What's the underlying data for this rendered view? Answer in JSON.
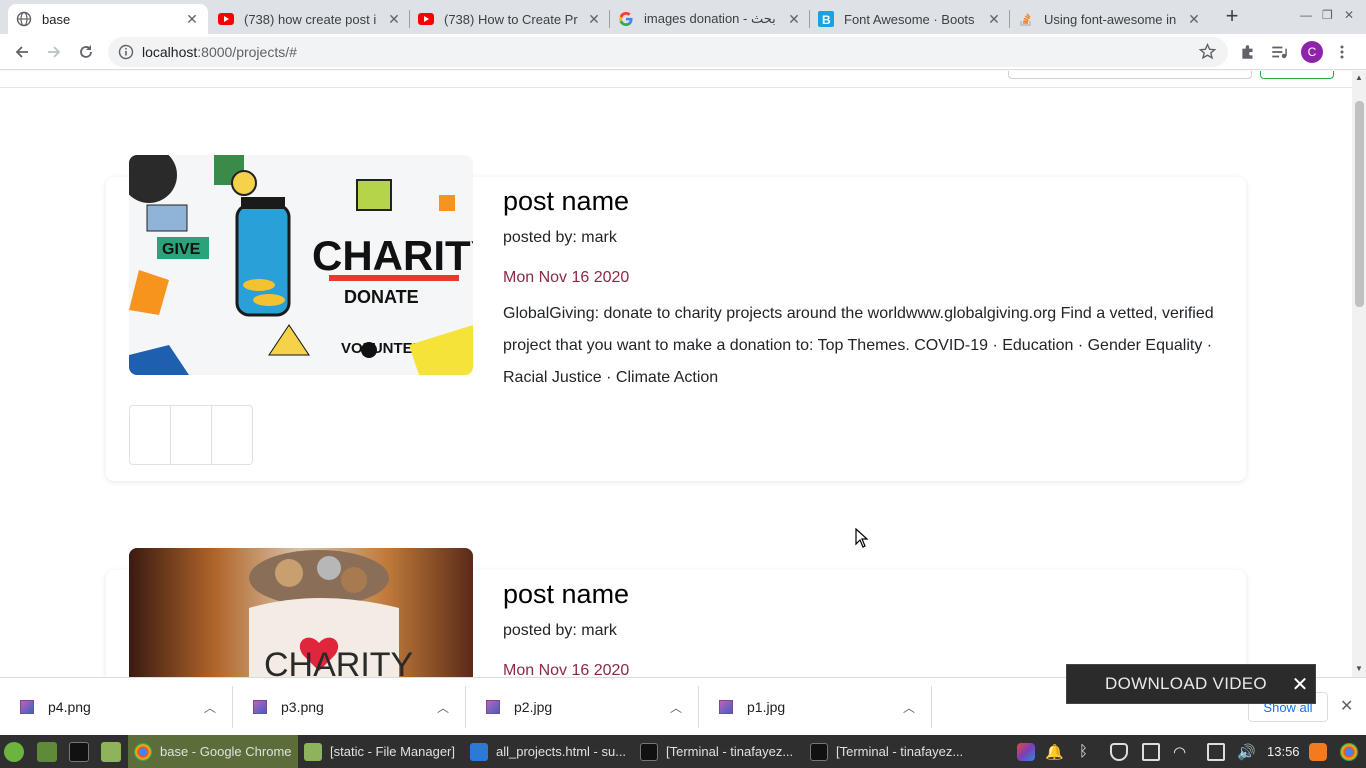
{
  "browser": {
    "tabs": [
      {
        "title": "base",
        "favicon": "globe-icon",
        "active": true
      },
      {
        "title": "(738) how create post i",
        "favicon": "youtube-icon",
        "active": false
      },
      {
        "title": "(738) How to Create Pr",
        "favicon": "youtube-icon",
        "active": false
      },
      {
        "title": "images donation - بحث",
        "favicon": "google-icon",
        "active": false
      },
      {
        "title": "Font Awesome · Boots",
        "favicon": "bootstrap-icon",
        "active": false
      },
      {
        "title": "Using font-awesome in",
        "favicon": "stackoverflow-icon",
        "active": false
      }
    ],
    "address": {
      "host": "localhost",
      "rest": ":8000/projects/#"
    },
    "profile_initial": "C"
  },
  "posts": [
    {
      "title": "post name",
      "author": "posted by: mark",
      "date": "Mon Nov 16 2020",
      "description": "GlobalGiving: donate to charity projects around the worldwww.globalgiving.org Find a vetted, verified project that you want to make a donation to: Top Themes. COVID-19 · Education · Gender Equality · Racial Justice · Climate Action",
      "image_text": [
        "CHARITY",
        "GIVE",
        "DONATE",
        "VOLUNTEER"
      ]
    },
    {
      "title": "post name",
      "author": "posted by: mark",
      "date": "Mon Nov 16 2020",
      "image_text": [
        "CHARITY"
      ]
    }
  ],
  "overlay": {
    "download_video_label": "DOWNLOAD VIDEO"
  },
  "downloads": {
    "files": [
      "p4.png",
      "p3.png",
      "p2.jpg",
      "p1.jpg"
    ],
    "show_all_label": "Show all"
  },
  "taskbar": {
    "windows": [
      {
        "label": "base - Google Chrome",
        "active": true
      },
      {
        "label": "[static - File Manager]",
        "active": false
      },
      {
        "label": "all_projects.html - su...",
        "active": false
      },
      {
        "label": "[Terminal - tinafayez...",
        "active": false
      },
      {
        "label": "[Terminal - tinafayez...",
        "active": false
      }
    ],
    "clock": "13:56"
  },
  "colors": {
    "date": "#8b2a45",
    "taskbar_active": "#5b6e3a",
    "profile": "#8e24aa"
  }
}
